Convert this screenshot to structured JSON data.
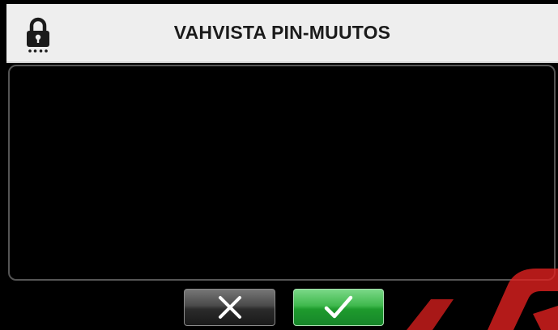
{
  "header": {
    "title": "VAHVISTA PIN-MUUTOS",
    "icon": "lock-icon"
  },
  "content": {
    "text": ""
  },
  "buttons": {
    "cancel": {
      "icon": "close-icon"
    },
    "confirm": {
      "icon": "check-icon"
    }
  },
  "colors": {
    "header_bg": "#eeeeee",
    "screen_bg": "#000000",
    "confirm_green": "#2fae3d",
    "cancel_dark": "#3a3a3a"
  }
}
